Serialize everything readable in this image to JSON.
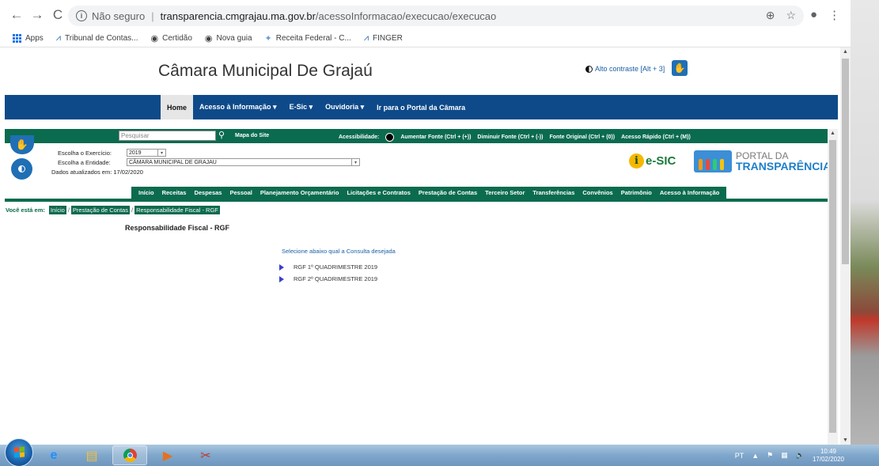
{
  "browser": {
    "security_label": "Não seguro",
    "url_host": "transparencia.cmgrajau.ma.gov.br",
    "url_path": "/acessoInformacao/execucao/execucao",
    "bookmarks": [
      "Apps",
      "Tribunal de Contas...",
      "Certidão",
      "Nova guia",
      "Receita Federal - C...",
      "FINGER"
    ]
  },
  "header": {
    "site_title": "Câmara Municipal De Grajaú",
    "contrast_link": "Alto contraste [Alt + 3]"
  },
  "main_nav": {
    "items": [
      "Home",
      "Acesso à Informação ▾",
      "E-Sic ▾",
      "Ouvidoria ▾",
      "Ir para o Portal da Câmara"
    ]
  },
  "toolbar": {
    "search_placeholder": "Pesquisar",
    "site_map": "Mapa do Site",
    "accessibility_label": "Acessibilidade:",
    "increase_font": "Aumentar Fonte (Ctrl + (+))",
    "decrease_font": "Diminuir Fonte (Ctrl + (-))",
    "original_font": "Fonte Original (Ctrl + (0))",
    "quick_access": "Acesso Rápido (Ctrl + (M))"
  },
  "filters": {
    "year_label": "Escolha o Exercício:",
    "year_value": "2019",
    "entity_label": "Escolha a Entidade:",
    "entity_value": "CÂMARA MUNICIPAL DE GRAJAU",
    "updated": "Dados atualizados em: 17/02/2020"
  },
  "logos": {
    "esic": "e-SIC",
    "esic_i": "i",
    "portal_line1": "PORTAL DA",
    "portal_line2": "TRANSPARÊNCIA"
  },
  "sub_nav": {
    "items": [
      "Início",
      "Receitas",
      "Despesas",
      "Pessoal",
      "Planejamento Orçamentário",
      "Licitações e Contratos",
      "Prestação de Contas",
      "Terceiro Setor",
      "Transferências",
      "Convênios",
      "Patrimônio",
      "Acesso à Informação"
    ]
  },
  "breadcrumb": {
    "lead": "Você está em:",
    "items": [
      "Início",
      "Prestação de Contas",
      "Responsabilidade Fiscal - RGF"
    ]
  },
  "content": {
    "title": "Responsabilidade Fiscal - RGF",
    "select_prompt": "Selecione abaixo qual a Consulta desejada",
    "links": [
      "RGF 1º QUADRIMESTRE 2019",
      "RGF 2º QUADRIMESTRE 2019"
    ]
  },
  "taskbar": {
    "lang": "PT",
    "time": "10:49",
    "date": "17/02/2020"
  },
  "colors": {
    "nav_blue": "#0e4a8a",
    "green": "#0b6b4e",
    "link_blue": "#1b5fa6"
  }
}
